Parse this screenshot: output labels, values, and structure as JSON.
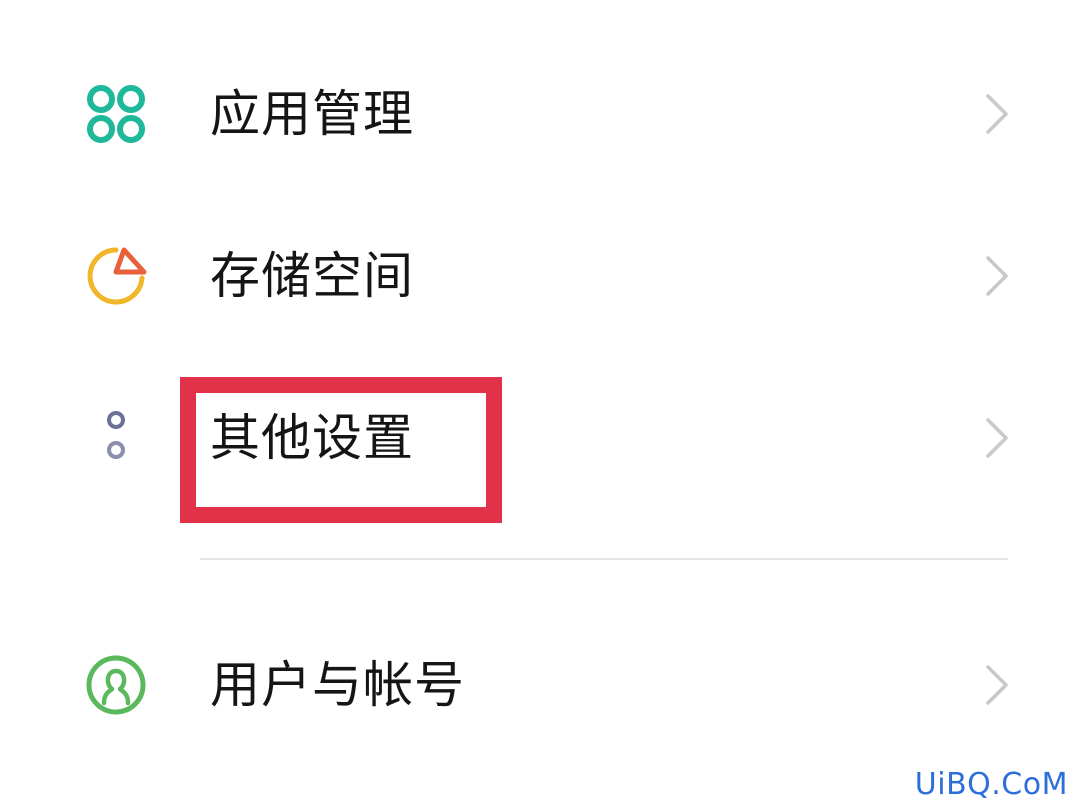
{
  "settings_list": {
    "items": [
      {
        "id": "apps",
        "label": "应用管理",
        "icon": "app-grid-icon"
      },
      {
        "id": "storage",
        "label": "存储空间",
        "icon": "pie-chart-icon"
      },
      {
        "id": "other",
        "label": "其他设置",
        "icon": "more-dots-icon",
        "highlighted": true
      },
      {
        "id": "users",
        "label": "用户与帐号",
        "icon": "user-circle-icon"
      }
    ]
  },
  "watermark": "UiBQ.CoM",
  "colors": {
    "apps_icon": "#1fb89a",
    "storage_icon_ring": "#f0b72a",
    "storage_icon_slice": "#e8603c",
    "other_icon": "#6b7296",
    "users_icon": "#5cb85c",
    "highlight": "#e2324a",
    "chevron": "#c8c8c8",
    "watermark": "#2c6fd8"
  }
}
